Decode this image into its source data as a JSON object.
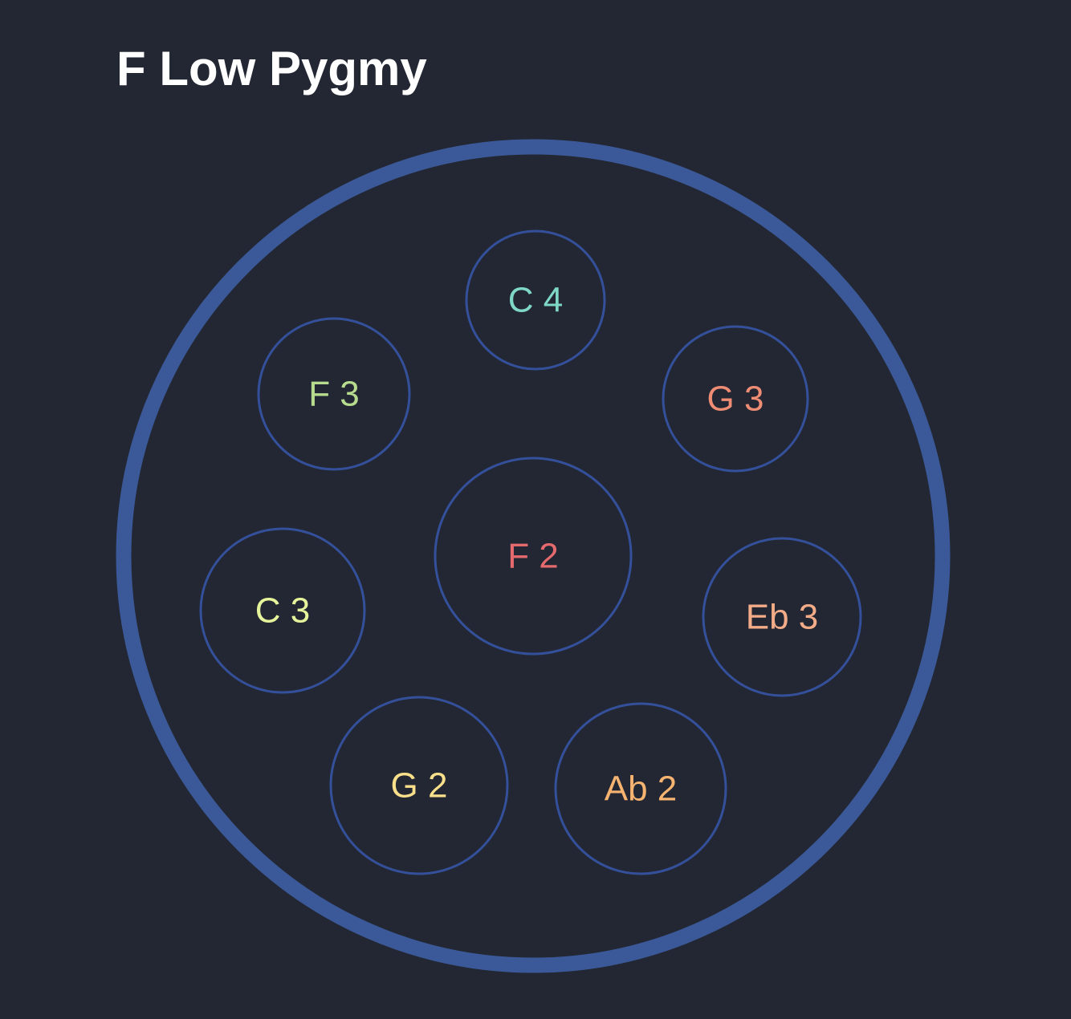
{
  "title": "F Low Pygmy",
  "colors": {
    "background": "#222733",
    "title": "#ffffff",
    "drum_outline": "#3b5998",
    "note_outline": "#34509a"
  },
  "notes": [
    {
      "id": "ding",
      "label": "F 2",
      "color": "#e46a6e"
    },
    {
      "id": "c4",
      "label": "C 4",
      "color": "#7fd8c6"
    },
    {
      "id": "f3",
      "label": "F 3",
      "color": "#b7dc8e"
    },
    {
      "id": "g3",
      "label": "G 3",
      "color": "#ee8c74"
    },
    {
      "id": "c3",
      "label": "C 3",
      "color": "#e6f59b"
    },
    {
      "id": "eb3",
      "label": "Eb 3",
      "color": "#f3ab88"
    },
    {
      "id": "g2",
      "label": "G 2",
      "color": "#fae08b"
    },
    {
      "id": "ab2",
      "label": "Ab 2",
      "color": "#f7b471"
    }
  ]
}
